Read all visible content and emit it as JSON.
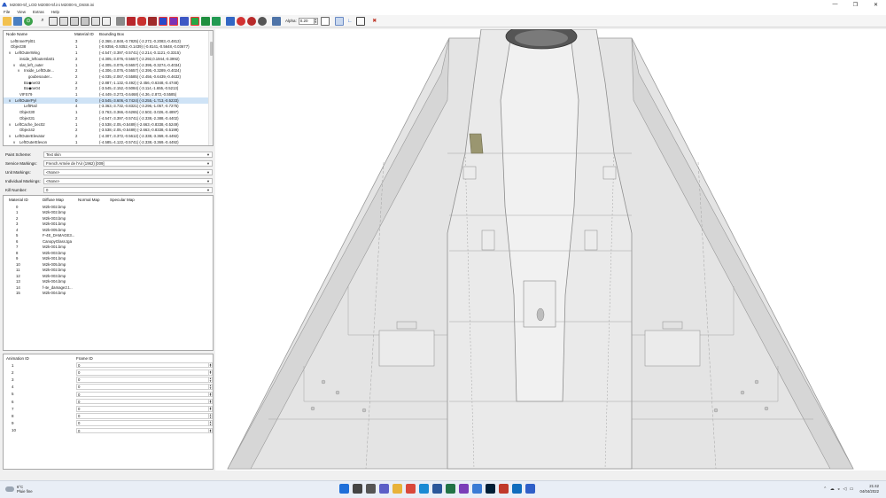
{
  "window": {
    "title": "M2000-5f_LOD M2000-5f.ini M2000-5_D6S8.ini",
    "minimize": "—",
    "maximize": "❐",
    "close": "✕"
  },
  "menu": [
    "File",
    "View",
    "Extras",
    "Help"
  ],
  "toolbar": {
    "alpha_label": "Alpha:",
    "alpha_value": "0.20"
  },
  "tree": {
    "headers": {
      "name": "Node Name",
      "material": "Material ID",
      "bbox": "Bounding Box"
    },
    "rows": [
      {
        "name": "LeftInnerPyl01",
        "indent": 0,
        "expander": "",
        "mat": "3",
        "bbox": "(-2.368,-2.848,-0.7825) (-2.272,-0.2083,-0.4813)"
      },
      {
        "name": "Object38",
        "indent": 0,
        "expander": "",
        "mat": "1",
        "bbox": "(-0.9356,-0.9352,-0.1439) (-0.8141,-0.5648,-0.03677)"
      },
      {
        "name": "LeftOuterWing",
        "indent": 1,
        "expander": "v",
        "mat": "1",
        "bbox": "(-4.547,-3.397,-0.5741) (-2.214,-0.1121,-0.3315)"
      },
      {
        "name": "inside_leftoutersla01",
        "indent": 2,
        "expander": "",
        "mat": "2",
        "bbox": "(-4.305,-3.076,-0.5657) (-2.292,0.1944,-0.3992)"
      },
      {
        "name": "slat_left_outer",
        "indent": 2,
        "expander": "v",
        "mat": "1",
        "bbox": "(-4.305,-3.076,-0.5657) (-2.395,-0.3274,-0.4034)"
      },
      {
        "name": "Inside_LeftOute...",
        "indent": 3,
        "expander": "v",
        "mat": "2",
        "bbox": "(-4.306,-3.076,-0.5657) (-2.395,-0.3289,-0.4024)"
      },
      {
        "name": "goubesouter...",
        "indent": 4,
        "expander": "",
        "mat": "2",
        "bbox": "(-4.035,-2.067,-0.5585) (-2.456,-0.6439,-0.4632)"
      },
      {
        "name": "Bo◆ne03",
        "indent": 3,
        "expander": "",
        "mat": "2",
        "bbox": "(-2.887,-1.132,-0.492) (-2.456,-0.6348,-0.4748)"
      },
      {
        "name": "Bo◆ne04",
        "indent": 3,
        "expander": "",
        "mat": "2",
        "bbox": "(-3.545,-2.152,-0.5084) (-3.114,-1.655,-0.5213)"
      },
      {
        "name": "VIFS79",
        "indent": 2,
        "expander": "",
        "mat": "1",
        "bbox": "(-4.449,-3.273,-0.6468) (-4.36,-2.872,-0.5585)"
      },
      {
        "name": "LeftOuterPyl",
        "indent": 1,
        "expander": "v",
        "mat": "0",
        "bbox": "(-3.545,-3.606,-0.7424) (-3.255,-1.713,-0.5233)",
        "selected": true
      },
      {
        "name": "LeftRail",
        "indent": 3,
        "expander": "",
        "mat": "4",
        "bbox": "(-3.363,-3.732,-0.8321) (-3.296,-1.057,-0.7275)"
      },
      {
        "name": "Object30",
        "indent": 2,
        "expander": "",
        "mat": "1",
        "bbox": "(-3.763,-3.366,-0.6265) (-2.502,-3.026,-0.4897)"
      },
      {
        "name": "Object31",
        "indent": 2,
        "expander": "",
        "mat": "2",
        "bbox": "(-4.547,-3.397,-0.5741) (-2.338,-2.388,-0.4402)"
      },
      {
        "name": "LeftCache_bec02",
        "indent": 1,
        "expander": "v",
        "mat": "1",
        "bbox": "(-3.538,-2.05,-0.5489) (-2.663,-0.8338,-0.5249)"
      },
      {
        "name": "Object42",
        "indent": 2,
        "expander": "",
        "mat": "2",
        "bbox": "(-3.538,-2.05,-0.5489) (-2.663,-0.8338,-0.5199)"
      },
      {
        "name": "LeftOuterElevator",
        "indent": 1,
        "expander": "v",
        "mat": "2",
        "bbox": "(-4.307,-3.372,-0.5612) (-2.338,-3.369,-0.4492)"
      },
      {
        "name": "LeftOuterElevon",
        "indent": 2,
        "expander": "v",
        "mat": "1",
        "bbox": "(-4.585,-4.122,-0.5741) (-2.338,-3.369,-0.4492)"
      }
    ]
  },
  "form": {
    "paint_scheme": {
      "label": "Paint Scheme:",
      "value": "Text skin"
    },
    "service_markings": {
      "label": "Service Markings:",
      "value": "French Armée de l'Air (1962) [009]"
    },
    "unit_markings": {
      "label": "Unit Markings:",
      "value": "<None>"
    },
    "individual_markings": {
      "label": "Individual Markings:",
      "value": "<None>"
    },
    "kill_number": {
      "label": "Kill Number:",
      "value": "0"
    }
  },
  "materials": {
    "headers": {
      "id": "Material ID",
      "diffuse": "Diffuse Map",
      "normal": "Normal Map",
      "specular": "Specular Map"
    },
    "rows": [
      {
        "id": "0",
        "diffuse": "M2k-002.bmp"
      },
      {
        "id": "1",
        "diffuse": "M2k-002.bmp"
      },
      {
        "id": "2",
        "diffuse": "M2k-003.bmp"
      },
      {
        "id": "3",
        "diffuse": "M2k-001.bmp"
      },
      {
        "id": "4",
        "diffuse": "M2k-005.bmp"
      },
      {
        "id": "5",
        "diffuse": "F-4E_DAMAGE3..."
      },
      {
        "id": "6",
        "diffuse": "CanopyGlass.tga"
      },
      {
        "id": "7",
        "diffuse": "M2k-001.bmp"
      },
      {
        "id": "8",
        "diffuse": "M2k-003.bmp"
      },
      {
        "id": "9",
        "diffuse": "M2k-001.bmp"
      },
      {
        "id": "10",
        "diffuse": "M2k-005.bmp"
      },
      {
        "id": "11",
        "diffuse": "M2k-002.bmp"
      },
      {
        "id": "12",
        "diffuse": "M2k-003.bmp"
      },
      {
        "id": "13",
        "diffuse": "M2k-004.bmp"
      },
      {
        "id": "14",
        "diffuse": "f-4e_damage2.t..."
      },
      {
        "id": "15",
        "diffuse": "M2k-004.bmp"
      }
    ]
  },
  "animation": {
    "headers": {
      "id": "Animation ID",
      "frame": "Frame ID"
    },
    "rows": [
      {
        "id": "1",
        "frame": "0"
      },
      {
        "id": "2",
        "frame": "0"
      },
      {
        "id": "3",
        "frame": "0"
      },
      {
        "id": "4",
        "frame": "0"
      },
      {
        "id": "5",
        "frame": "0"
      },
      {
        "id": "6",
        "frame": "0"
      },
      {
        "id": "7",
        "frame": "0"
      },
      {
        "id": "8",
        "frame": "0"
      },
      {
        "id": "9",
        "frame": "0"
      },
      {
        "id": "10",
        "frame": "0"
      }
    ]
  },
  "taskbar": {
    "weather_temp": "6°C",
    "weather_desc": "Pluie fine",
    "time": "21:42",
    "date": "04/04/2022",
    "apps": [
      {
        "icon": "windows-start-icon",
        "color": "#1e6fd9"
      },
      {
        "icon": "search-icon",
        "color": "#444444"
      },
      {
        "icon": "task-view-icon",
        "color": "#555555"
      },
      {
        "icon": "chat-icon",
        "color": "#5b5fc7"
      },
      {
        "icon": "file-explorer-icon",
        "color": "#e8b23a"
      },
      {
        "icon": "chrome-icon",
        "color": "#d9483b"
      },
      {
        "icon": "edge-icon",
        "color": "#1a8ad4"
      },
      {
        "icon": "word-icon",
        "color": "#2b579a"
      },
      {
        "icon": "excel-icon",
        "color": "#217346"
      },
      {
        "icon": "photos-icon",
        "color": "#7a3db8"
      },
      {
        "icon": "settings-icon",
        "color": "#3a7bd5"
      },
      {
        "icon": "photoshop-icon",
        "color": "#001e36"
      },
      {
        "icon": "game-icon",
        "color": "#c0392b"
      },
      {
        "icon": "mail-icon",
        "color": "#0f6cbd"
      },
      {
        "icon": "lod-viewer-icon",
        "color": "#2f5fc8"
      }
    ]
  },
  "colors": {
    "selection": "#cfe3f6",
    "viewport_bg": "#ffffff",
    "model": "#e3e3e3"
  }
}
